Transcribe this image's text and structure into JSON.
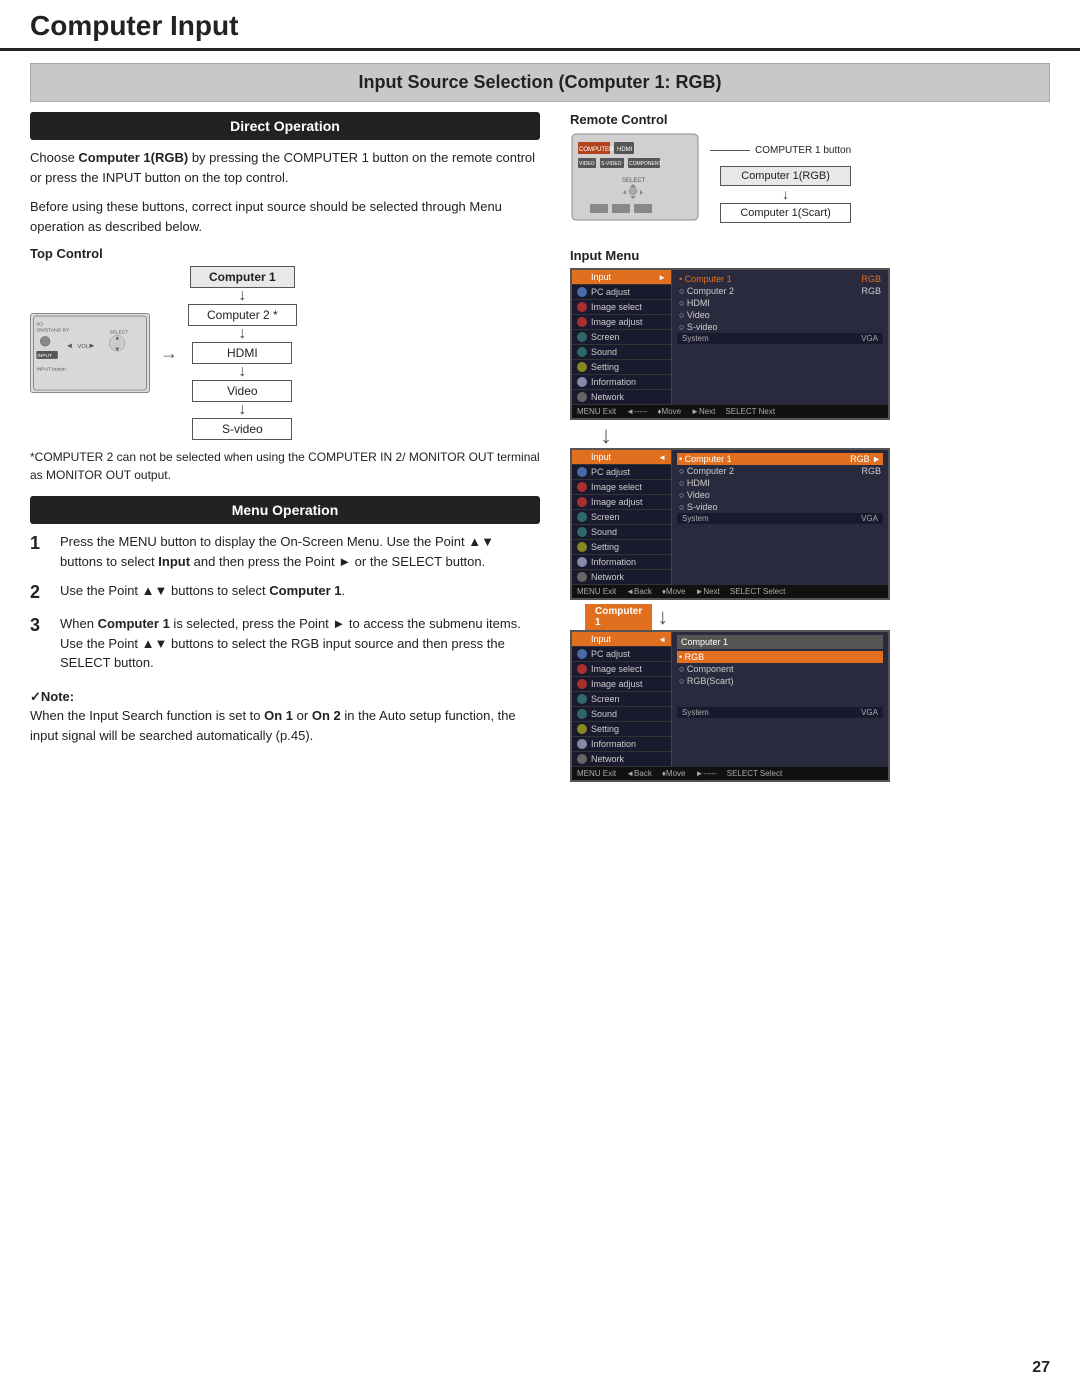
{
  "page": {
    "title": "Computer Input",
    "page_number": "27"
  },
  "section": {
    "title": "Input Source Selection (Computer 1: RGB)"
  },
  "direct_operation": {
    "label": "Direct Operation",
    "body1": "Choose Computer 1(RGB) by pressing the COMPUTER 1 button on the remote control or press the INPUT button on the top control.",
    "body2": "Before using these buttons, correct input source should be selected through Menu operation as described below.",
    "top_control_label": "Top Control",
    "input_button_label": "INPUT button",
    "flow_items": [
      "Computer 1",
      "Computer 2 *",
      "HDMI",
      "Video",
      "S-video"
    ],
    "note": "*COMPUTER 2 can not be selected when using the COMPUTER IN 2/ MONITOR OUT terminal as MONITOR OUT output."
  },
  "remote_control": {
    "label": "Remote Control",
    "computer1_button_label": "COMPUTER 1 button",
    "flow_items": [
      "Computer 1(RGB)",
      "Computer 1(Scart)"
    ],
    "rc_buttons": [
      "COMPUTER",
      "HDMI",
      "VIDEO",
      "S-VIDEO",
      "COMPONENT"
    ]
  },
  "input_menu": {
    "label": "Input Menu",
    "menu1": {
      "left_items": [
        "Input",
        "PC adjust",
        "Image select",
        "Image adjust",
        "Screen",
        "Sound",
        "Setting",
        "Information",
        "Network"
      ],
      "right_items": [
        "• Computer 1",
        "○ Computer 2",
        "○ HDMI",
        "○ Video",
        "○ S-video"
      ],
      "right_labels": [
        "RGB",
        "RGB",
        "",
        "",
        ""
      ],
      "system_left": "System",
      "system_right": "VGA",
      "bottom_bar": [
        "MENU Exit",
        "◄----- ♦Move",
        "►Next",
        "SELECT Next"
      ]
    },
    "menu2": {
      "active_item": "Input",
      "right_items": [
        "• Computer 1",
        "○ Computer 2",
        "○ HDMI",
        "○ Video",
        "○ S-video"
      ],
      "right_labels": [
        "RGB",
        "RGB",
        "",
        "",
        ""
      ],
      "system_left": "System",
      "system_right": "VGA",
      "bottom_bar": [
        "MENU Exit",
        "◄Back",
        "♦Move",
        "►Next",
        "SELECT Select"
      ]
    },
    "menu3": {
      "active_item": "Input",
      "right_title": "Computer 1",
      "right_items": [
        "• RGB",
        "○ Component",
        "○ RGB(Scart)"
      ],
      "system_left": "System",
      "system_right": "VGA",
      "bottom_bar": [
        "MENU Exit",
        "◄Back",
        "♦Move",
        "►-----",
        "SELECT Select"
      ]
    },
    "computer_label": "Computer 1"
  },
  "menu_operation": {
    "label": "Menu Operation",
    "steps": [
      {
        "num": "1",
        "text": "Press the MENU button to display the On-Screen Menu. Use the Point ▲▼ buttons to select Input and then press the Point ► or the SELECT button."
      },
      {
        "num": "2",
        "text": "Use the Point ▲▼ buttons to select Computer 1."
      },
      {
        "num": "3",
        "text": "When Computer 1 is selected, press the Point ► to access the submenu items. Use the Point ▲▼ buttons to select the RGB input source and then press the SELECT button."
      }
    ]
  },
  "note_section": {
    "check": "✓",
    "note_label": "Note:",
    "note_text": "When the Input Search function is set to On 1 or On 2 in the Auto setup function, the input signal will be searched automatically (p.45)."
  }
}
